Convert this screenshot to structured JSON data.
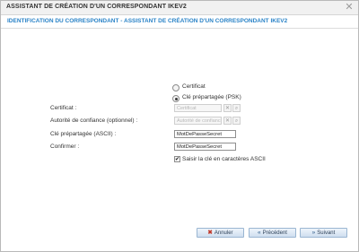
{
  "window": {
    "title": "ASSISTANT DE CRÉATION D'UN CORRESPONDANT IKEV2",
    "close_glyph": "✕"
  },
  "header": {
    "subtitle": "IDENTIFICATION DU CORRESPONDANT - ASSISTANT DE CRÉATION D'UN CORRESPONDANT IKEV2"
  },
  "auth": {
    "options": [
      {
        "label": "Certificat",
        "selected": false
      },
      {
        "label": "Clé prépartagée (PSK)",
        "selected": true
      }
    ]
  },
  "form": {
    "certificate": {
      "label": "Certificat :",
      "placeholder": "Certificat",
      "disabled": true
    },
    "authority": {
      "label": "Autorité de confiance (optionnel) :",
      "placeholder": "Autorité de confiance",
      "disabled": true
    },
    "psk": {
      "label": "Clé prépartagée (ASCII) :",
      "value": "MotDePasseSecret"
    },
    "confirm": {
      "label": "Confirmer :",
      "value": "MotDePasseSecret"
    },
    "ascii_checkbox": {
      "label": "Saisir la clé en caractères ASCII",
      "checked": true
    }
  },
  "buttons": {
    "cancel": {
      "label": "Annuler",
      "icon": "close-icon"
    },
    "previous": {
      "label": "Précédent",
      "icon": "double-chevron-left-icon"
    },
    "next": {
      "label": "Suivant",
      "icon": "double-chevron-right-icon"
    }
  },
  "colors": {
    "accent": "#2a83c7",
    "button_border": "#9ab6d2"
  }
}
